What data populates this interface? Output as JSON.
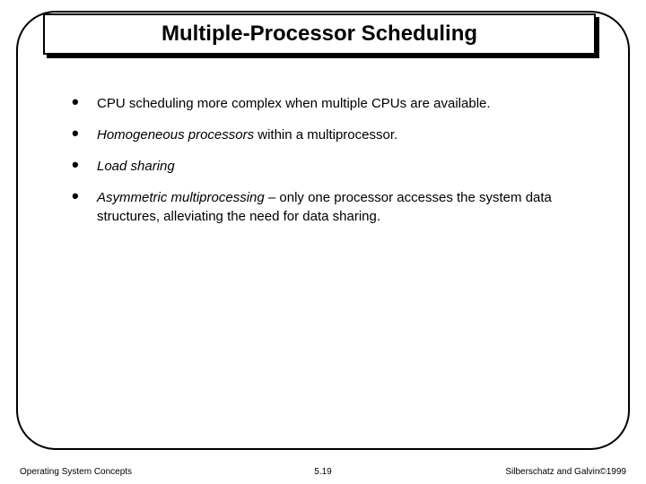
{
  "title": "Multiple-Processor Scheduling",
  "bullets": {
    "b1": "CPU scheduling more complex when multiple CPUs are available.",
    "b2_ital": "Homogeneous processors",
    "b2_rest": " within a multiprocessor.",
    "b3_ital": "Load sharing",
    "b4_ital": "Asymmetric multiprocessing",
    "b4_rest": " – only one processor accesses the system data structures, alleviating the need for data sharing."
  },
  "footer": {
    "left": "Operating System Concepts",
    "center": "5.19",
    "right": "Silberschatz and Galvin©1999"
  }
}
